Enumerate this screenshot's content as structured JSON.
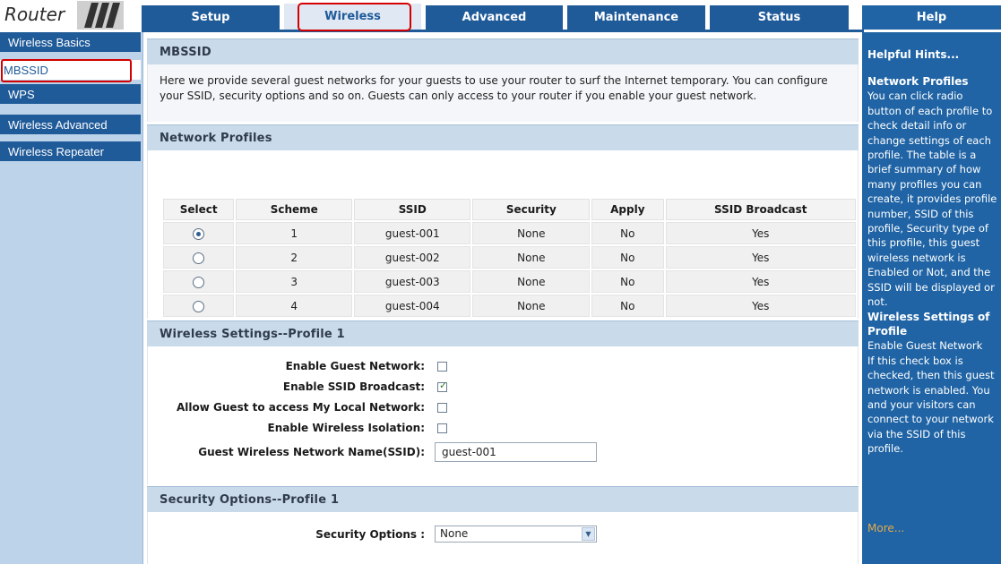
{
  "logo": {
    "text": "Router"
  },
  "nav": {
    "tabs": [
      {
        "label": "Setup"
      },
      {
        "label": "Wireless"
      },
      {
        "label": "Advanced"
      },
      {
        "label": "Maintenance"
      },
      {
        "label": "Status"
      },
      {
        "label": "Help"
      }
    ],
    "active_tab": "Wireless"
  },
  "sidebar": {
    "items": [
      {
        "label": "Wireless Basics"
      },
      {
        "label": "MBSSID"
      },
      {
        "label": "WPS"
      },
      {
        "label": "Wireless Advanced"
      },
      {
        "label": "Wireless Repeater"
      }
    ],
    "active_item": "MBSSID"
  },
  "mbssid": {
    "title": "MBSSID",
    "description": "Here we provide several guest networks for your guests to use your router to surf the Internet temporary. You can configure your SSID, security options and so on. Guests can only access to your router if you enable your guest network."
  },
  "profiles": {
    "title": "Network Profiles",
    "columns": [
      "Select",
      "Scheme",
      "SSID",
      "Security",
      "Apply",
      "SSID Broadcast"
    ],
    "rows": [
      {
        "selected": true,
        "scheme": "1",
        "ssid": "guest-001",
        "security": "None",
        "apply": "No",
        "broadcast": "Yes"
      },
      {
        "selected": false,
        "scheme": "2",
        "ssid": "guest-002",
        "security": "None",
        "apply": "No",
        "broadcast": "Yes"
      },
      {
        "selected": false,
        "scheme": "3",
        "ssid": "guest-003",
        "security": "None",
        "apply": "No",
        "broadcast": "Yes"
      },
      {
        "selected": false,
        "scheme": "4",
        "ssid": "guest-004",
        "security": "None",
        "apply": "No",
        "broadcast": "Yes"
      }
    ]
  },
  "wireless_settings": {
    "title": "Wireless Settings--Profile 1",
    "fields": [
      {
        "label": "Enable Guest Network:",
        "checked": false
      },
      {
        "label": "Enable SSID Broadcast:",
        "checked": true
      },
      {
        "label": "Allow Guest to access My Local Network:",
        "checked": false
      },
      {
        "label": "Enable Wireless Isolation:",
        "checked": false
      }
    ],
    "ssid_label": "Guest Wireless Network Name(SSID):",
    "ssid_value": "guest-001"
  },
  "security": {
    "title": "Security Options--Profile 1",
    "label": "Security Options :",
    "value": "None"
  },
  "help": {
    "title": "Helpful Hints...",
    "section1_heading": "Network Profiles",
    "section1_text": "You can click radio button of each profile to check detail info or change settings of each profile. The table is a brief summary of how many profiles you can create, it provides profile number, SSID of this profile, Security type of this profile, this guest wireless network is Enabled or Not, and the SSID will be displayed or not.",
    "section2_heading": "Wireless Settings of Profile",
    "section2_text_1": "Enable Guest Network",
    "section2_text_2": "If this check box is checked, then this guest network is enabled. You and your visitors can connect to your network via the SSID of this profile.",
    "more_label": "More..."
  },
  "colors": {
    "nav_blue": "#1f5a99",
    "help_blue": "#2064a5",
    "panel_header": "#c9daeb",
    "highlight_red": "#d40000"
  }
}
